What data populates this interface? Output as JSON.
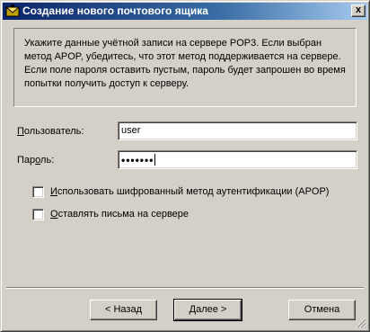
{
  "window": {
    "title": "Создание нового почтового ящика",
    "close_glyph": "x",
    "icon": "mailbox-icon"
  },
  "info": {
    "text": "Укажите данные учётной записи на сервере POP3. Если выбран метод APOP, убедитесь, что этот метод поддерживается на сервере. Если поле пароля оставить пустым, пароль будет запрошен во время попытки получить доступ к серверу."
  },
  "user": {
    "label_accel": "П",
    "label_rest": "ользователь:",
    "value": "user"
  },
  "password": {
    "label_pre": "Пар",
    "label_accel": "о",
    "label_rest": "ль:",
    "value": "•••••••"
  },
  "options": {
    "apop_label_pre": "",
    "apop_accel": "И",
    "apop_label_rest": "спользовать шифрованный метод аутентификации (APOP)",
    "apop_checked": false,
    "keep_label_pre": "",
    "keep_accel": "О",
    "keep_label_rest": "ставлять письма на сервере",
    "keep_checked": false
  },
  "buttons": {
    "back": "< Назад",
    "next": "Далее >",
    "cancel": "Отмена"
  },
  "colors": {
    "title_start": "#0a246a",
    "title_end": "#a6caf0",
    "face": "#d4d0c8"
  }
}
